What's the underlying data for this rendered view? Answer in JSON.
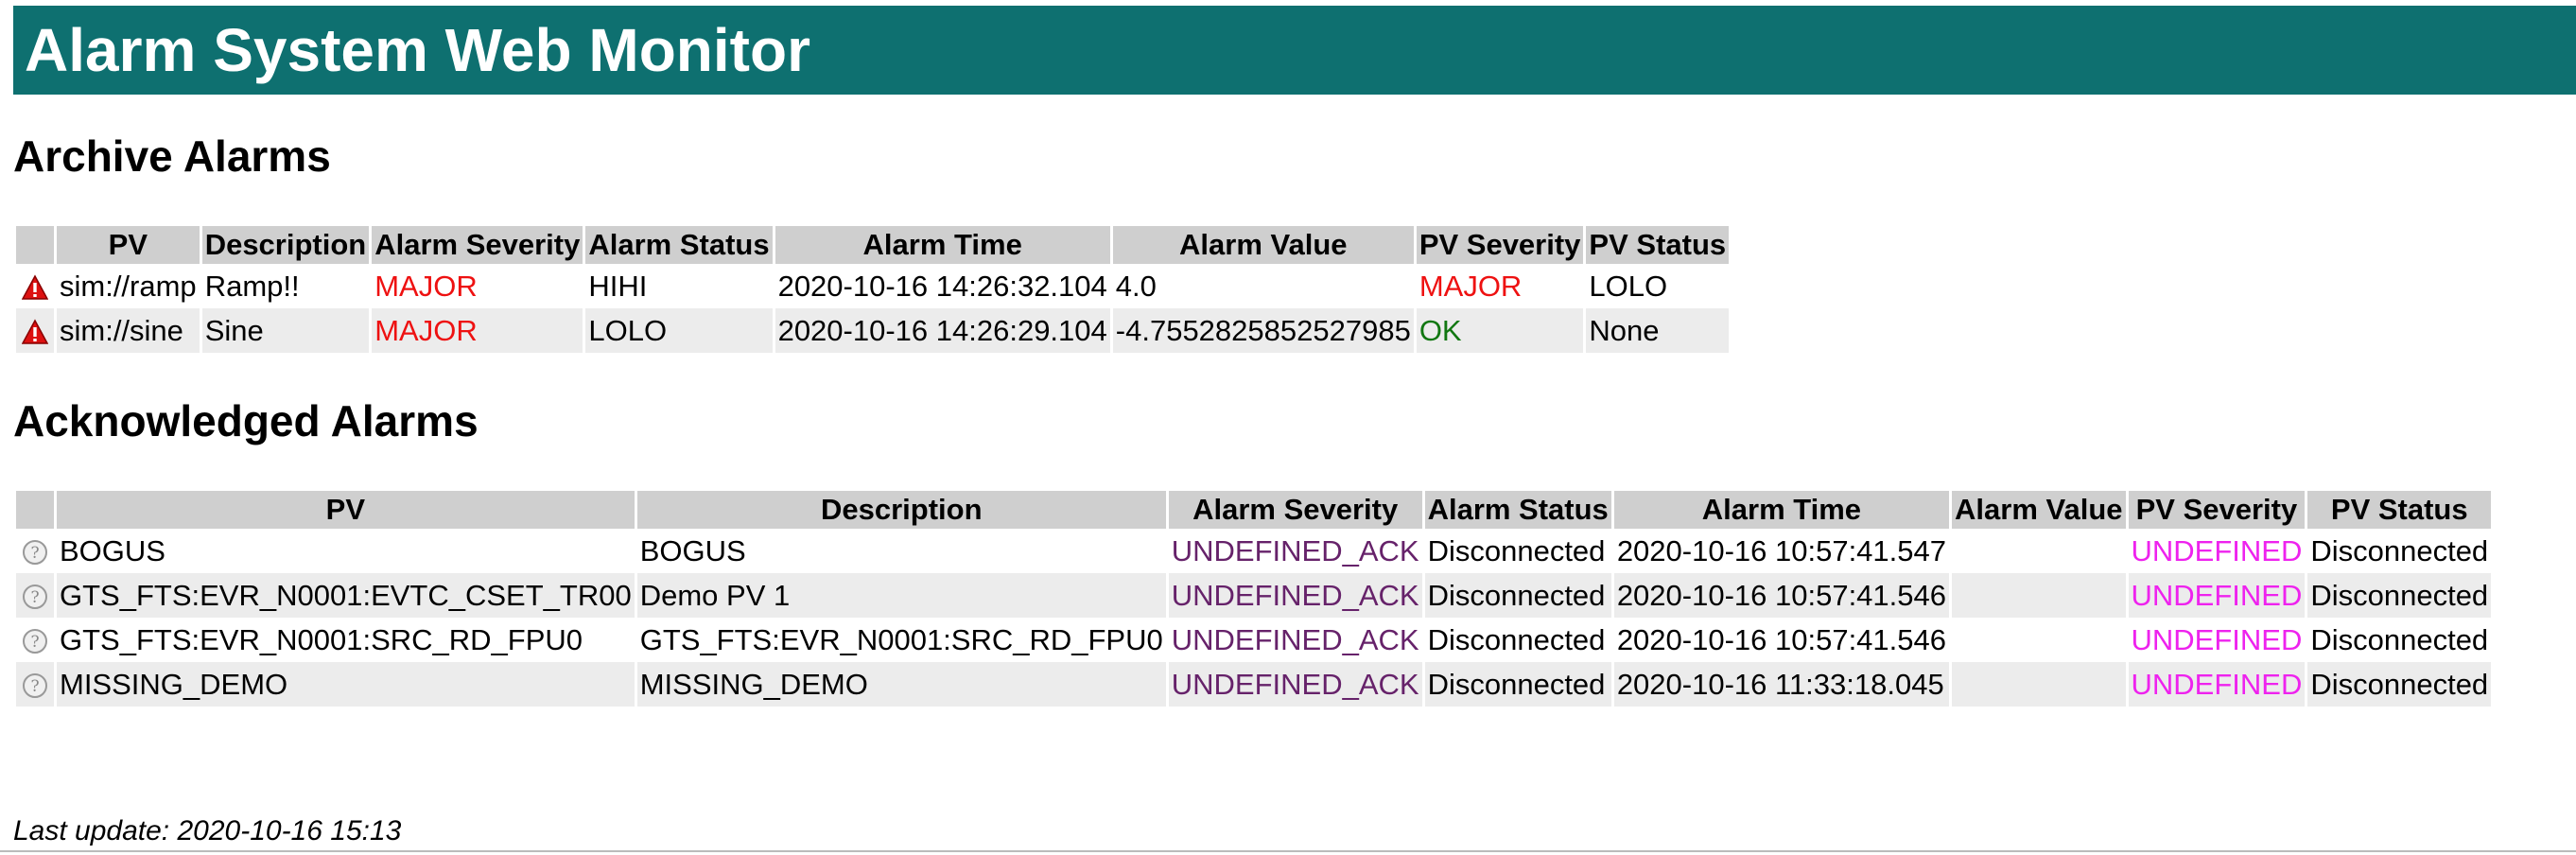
{
  "banner": {
    "title": "Alarm System Web Monitor"
  },
  "colors": {
    "banner": "#0e7070",
    "major": "#ee1111",
    "ok": "#117711",
    "undefined_ack": "#66226a",
    "undefined": "#ee22ee"
  },
  "archive": {
    "heading": "Archive Alarms",
    "columns": [
      "",
      "PV",
      "Description",
      "Alarm Severity",
      "Alarm Status",
      "Alarm Time",
      "Alarm Value",
      "PV Severity",
      "PV Status"
    ],
    "rows": [
      {
        "icon": "warning-icon",
        "pv": "sim://ramp",
        "description": "Ramp!!",
        "alarm_severity": "MAJOR",
        "alarm_status": "HIHI",
        "alarm_time": "2020-10-16 14:26:32.104",
        "alarm_value": "4.0",
        "pv_severity": "MAJOR",
        "pv_status": "LOLO"
      },
      {
        "icon": "warning-icon",
        "pv": "sim://sine",
        "description": "Sine",
        "alarm_severity": "MAJOR",
        "alarm_status": "LOLO",
        "alarm_time": "2020-10-16 14:26:29.104",
        "alarm_value": "-4.7552825852527985",
        "pv_severity": "OK",
        "pv_status": "None"
      }
    ]
  },
  "acknowledged": {
    "heading": "Acknowledged Alarms",
    "columns": [
      "",
      "PV",
      "Description",
      "Alarm Severity",
      "Alarm Status",
      "Alarm Time",
      "Alarm Value",
      "PV Severity",
      "PV Status"
    ],
    "rows": [
      {
        "icon": "question-icon",
        "pv": "BOGUS",
        "description": "BOGUS",
        "alarm_severity": "UNDEFINED_ACK",
        "alarm_status": "Disconnected",
        "alarm_time": "2020-10-16 10:57:41.547",
        "alarm_value": "",
        "pv_severity": "UNDEFINED",
        "pv_status": "Disconnected"
      },
      {
        "icon": "question-icon",
        "pv": "GTS_FTS:EVR_N0001:EVTC_CSET_TR00",
        "description": "Demo PV 1",
        "alarm_severity": "UNDEFINED_ACK",
        "alarm_status": "Disconnected",
        "alarm_time": "2020-10-16 10:57:41.546",
        "alarm_value": "",
        "pv_severity": "UNDEFINED",
        "pv_status": "Disconnected"
      },
      {
        "icon": "question-icon",
        "pv": "GTS_FTS:EVR_N0001:SRC_RD_FPU0",
        "description": "GTS_FTS:EVR_N0001:SRC_RD_FPU0",
        "alarm_severity": "UNDEFINED_ACK",
        "alarm_status": "Disconnected",
        "alarm_time": "2020-10-16 10:57:41.546",
        "alarm_value": "",
        "pv_severity": "UNDEFINED",
        "pv_status": "Disconnected"
      },
      {
        "icon": "question-icon",
        "pv": "MISSING_DEMO",
        "description": "MISSING_DEMO",
        "alarm_severity": "UNDEFINED_ACK",
        "alarm_status": "Disconnected",
        "alarm_time": "2020-10-16 11:33:18.045",
        "alarm_value": "",
        "pv_severity": "UNDEFINED",
        "pv_status": "Disconnected"
      }
    ]
  },
  "footer": {
    "last_update": "Last update: 2020-10-16 15:13"
  }
}
